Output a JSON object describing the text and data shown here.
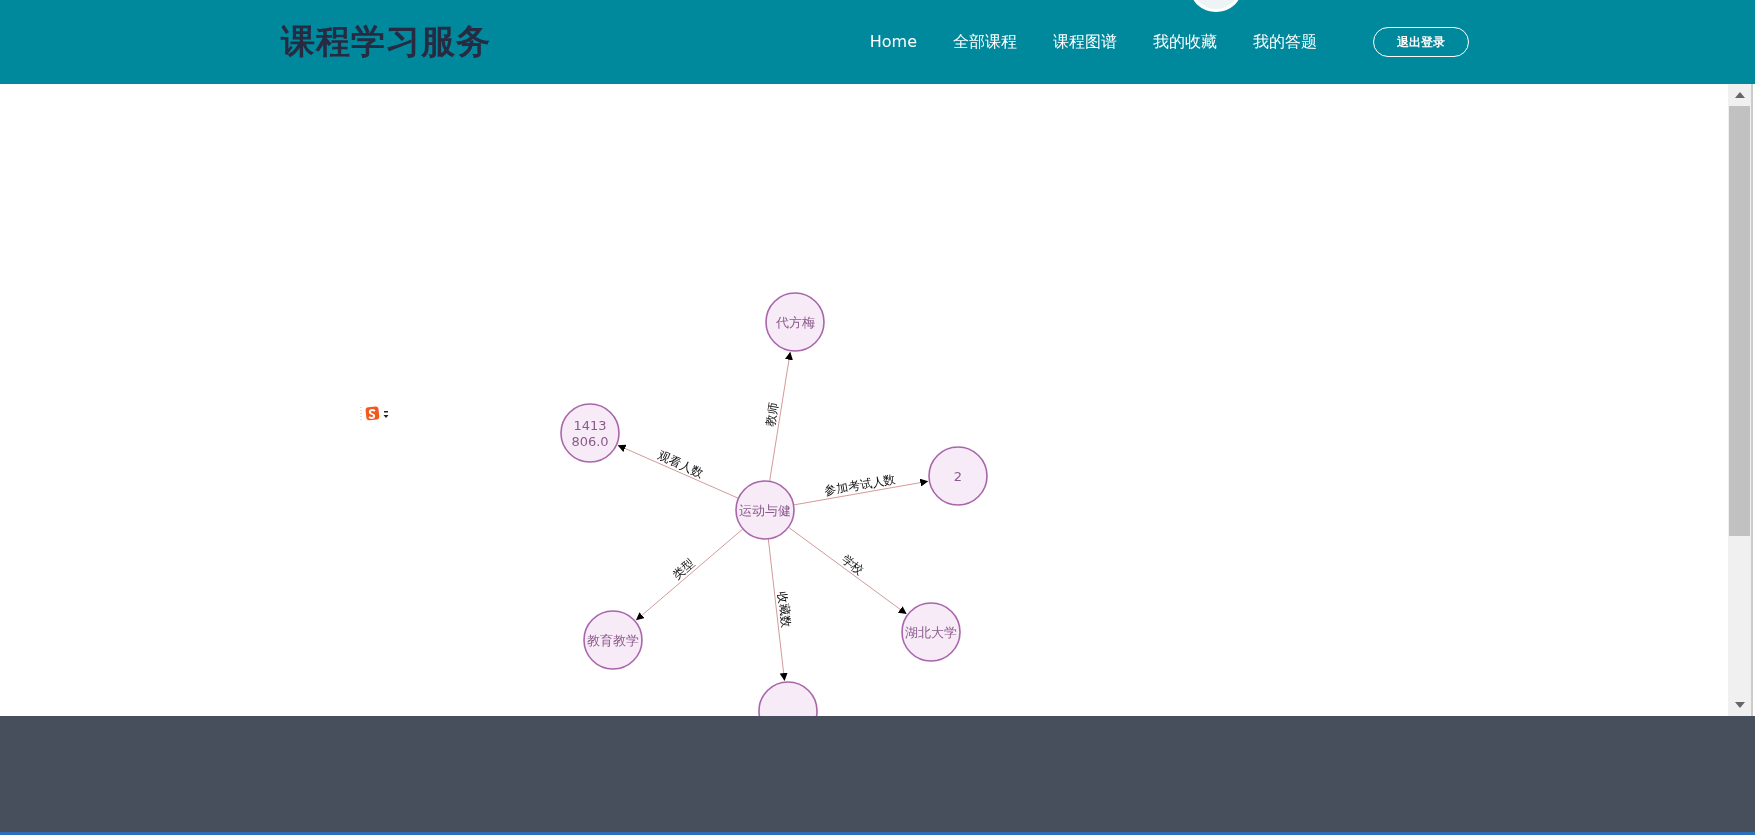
{
  "header": {
    "title": "课程学习服务",
    "nav": [
      {
        "label": "Home",
        "selected": false
      },
      {
        "label": "全部课程",
        "selected": false
      },
      {
        "label": "课程图谱",
        "selected": false
      },
      {
        "label": "我的收藏",
        "selected": false
      },
      {
        "label": "我的答题",
        "selected": false
      }
    ],
    "logout": "退出登录"
  },
  "graph": {
    "center": {
      "label": "运动与健"
    },
    "edges": [
      {
        "label": "教师",
        "target": {
          "label": "代方梅"
        }
      },
      {
        "label": "观看人数",
        "target": {
          "label": "1413\n806.0"
        }
      },
      {
        "label": "参加考试人数",
        "target": {
          "label": "2"
        }
      },
      {
        "label": "类型",
        "target": {
          "label": "教育教学"
        }
      },
      {
        "label": "学校",
        "target": {
          "label": "湖北大学"
        }
      },
      {
        "label": "收藏数"
      }
    ]
  }
}
